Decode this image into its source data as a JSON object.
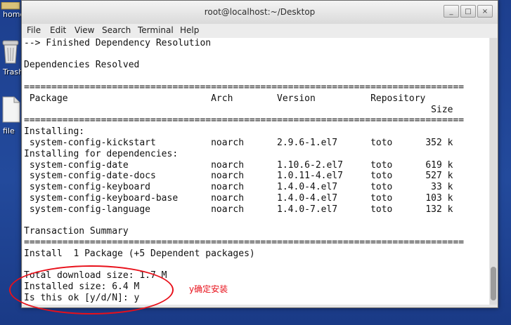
{
  "desktop": {
    "icons": [
      {
        "label": "home",
        "icon": "folder-icon"
      },
      {
        "label": "Trash",
        "icon": "trash-icon"
      },
      {
        "label": "file",
        "icon": "file-icon"
      }
    ]
  },
  "window": {
    "title": "root@localhost:~/Desktop",
    "controls": {
      "minimize": "_",
      "maximize": "□",
      "close": "×"
    }
  },
  "menubar": [
    "File",
    "Edit",
    "View",
    "Search",
    "Terminal",
    "Help"
  ],
  "terminal": {
    "lines": [
      "--> Finished Dependency Resolution",
      "",
      "Dependencies Resolved",
      "",
      "================================================================================",
      " Package                          Arch        Version          Repository",
      "                                                                          Size",
      "================================================================================",
      "Installing:",
      " system-config-kickstart          noarch      2.9.6-1.el7      toto      352 k",
      "Installing for dependencies:",
      " system-config-date               noarch      1.10.6-2.el7     toto      619 k",
      " system-config-date-docs          noarch      1.0.11-4.el7     toto      527 k",
      " system-config-keyboard           noarch      1.4.0-4.el7      toto       33 k",
      " system-config-keyboard-base      noarch      1.4.0-4.el7      toto      103 k",
      " system-config-language           noarch      1.4.0-7.el7      toto      132 k",
      "",
      "Transaction Summary",
      "================================================================================",
      "Install  1 Package (+5 Dependent packages)",
      "",
      "Total download size: 1.7 M",
      "Installed size: 6.4 M",
      "Is this ok [y/d/N]: y"
    ]
  },
  "annotation": {
    "note": "y确定安装",
    "color": "#e8101a"
  }
}
